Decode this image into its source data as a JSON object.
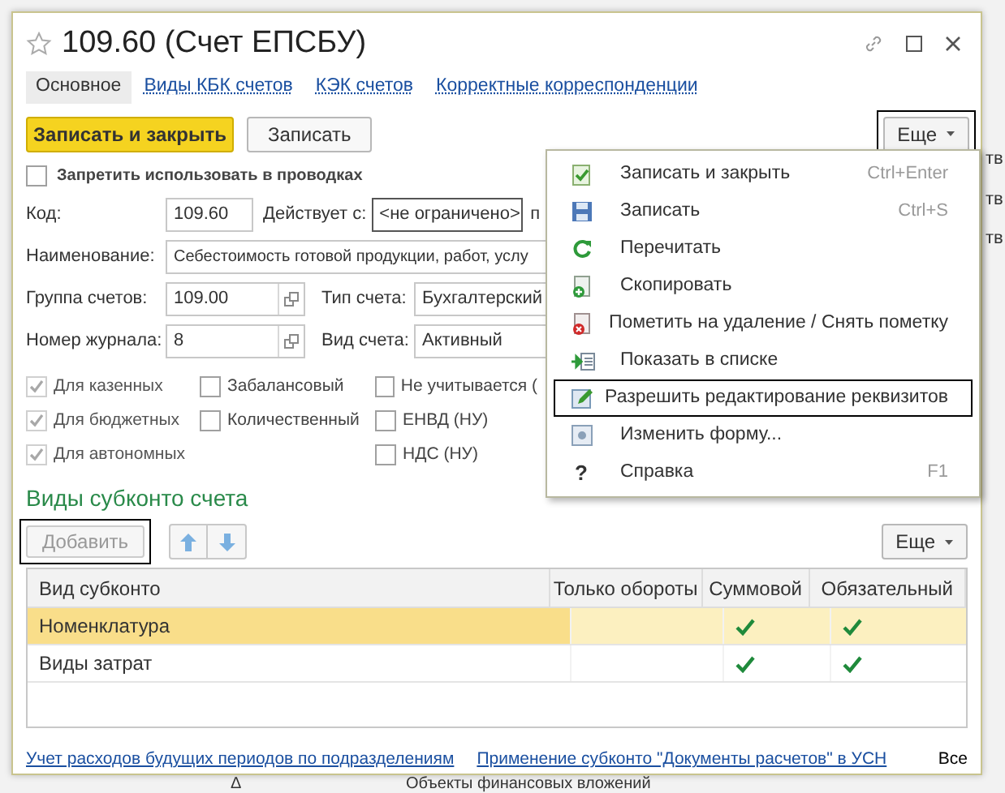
{
  "window": {
    "title": "109.60 (Счет ЕПСБУ)"
  },
  "tabs": [
    {
      "label": "Основное",
      "selected": true
    },
    {
      "label": "Виды КБК счетов",
      "selected": false
    },
    {
      "label": "КЭК счетов",
      "selected": false
    },
    {
      "label": "Корректные корреспонденции",
      "selected": false
    }
  ],
  "toolbar": {
    "primary": "Записать и закрыть",
    "save": "Записать",
    "more": "Еще"
  },
  "forbid": {
    "label": "Запретить использовать в проводках",
    "checked": false
  },
  "fields": {
    "code_label": "Код:",
    "code": "109.60",
    "valid_label": "Действует с:",
    "valid": "<не ограничено>",
    "valid_after": "п",
    "name_label": "Наименование:",
    "name": "Себестоимость готовой продукции, работ, услу",
    "group_label": "Группа счетов:",
    "group": "109.00",
    "type_label": "Тип счета:",
    "type": "Бухгалтерский",
    "journal_label": "Номер журнала:",
    "journal": "8",
    "kind_label": "Вид счета:",
    "kind": "Активный"
  },
  "flags": [
    [
      {
        "label": "Для казенных",
        "checked": true,
        "disabled": true
      },
      {
        "label": "Для бюджетных",
        "checked": true,
        "disabled": true
      },
      {
        "label": "Для автономных",
        "checked": true,
        "disabled": true
      }
    ],
    [
      {
        "label": "Забалансовый",
        "checked": false,
        "disabled": false
      },
      {
        "label": "Количественный",
        "checked": false,
        "disabled": false
      }
    ],
    [
      {
        "label": "Не учитывается (",
        "checked": false,
        "disabled": false
      },
      {
        "label": "ЕНВД (НУ)",
        "checked": false,
        "disabled": false
      },
      {
        "label": "НДС (НУ)",
        "checked": false,
        "disabled": false
      }
    ]
  ],
  "subconto": {
    "title": "Виды субконто счета",
    "add": "Добавить",
    "add_disabled": true,
    "more": "Еще",
    "columns": [
      "Вид субконто",
      "Только обороты",
      "Суммовой",
      "Обязательный"
    ],
    "rows": [
      {
        "name": "Номенклатура",
        "turnover_only": false,
        "sum": true,
        "required": true,
        "selected": true
      },
      {
        "name": "Виды затрат",
        "turnover_only": false,
        "sum": true,
        "required": true,
        "selected": false
      }
    ]
  },
  "footer_links": [
    "Учет расходов будущих периодов по подразделениям",
    "Применение субконто \"Документы расчетов\" в УСН"
  ],
  "footer_all": "Все",
  "menu": [
    {
      "label": "Записать и закрыть",
      "shortcut": "Ctrl+Enter",
      "selected": false
    },
    {
      "label": "Записать",
      "shortcut": "Ctrl+S",
      "selected": false
    },
    {
      "label": "Перечитать",
      "selected": false
    },
    {
      "label": "Скопировать",
      "selected": false
    },
    {
      "label": "Пометить на удаление / Снять пометку",
      "selected": false
    },
    {
      "label": "Показать в списке",
      "selected": false
    },
    {
      "label": "Разрешить редактирование реквизитов",
      "selected": true
    },
    {
      "label": "Изменить форму...",
      "selected": false
    },
    {
      "label": "Справка",
      "icon": "?",
      "shortcut": "F1",
      "selected": false
    }
  ],
  "background": {
    "right_fragments": [
      "тв",
      "тв",
      "тв"
    ],
    "bottom_mark": "Δ",
    "bottom_text": "Объекты финансовых вложений"
  }
}
